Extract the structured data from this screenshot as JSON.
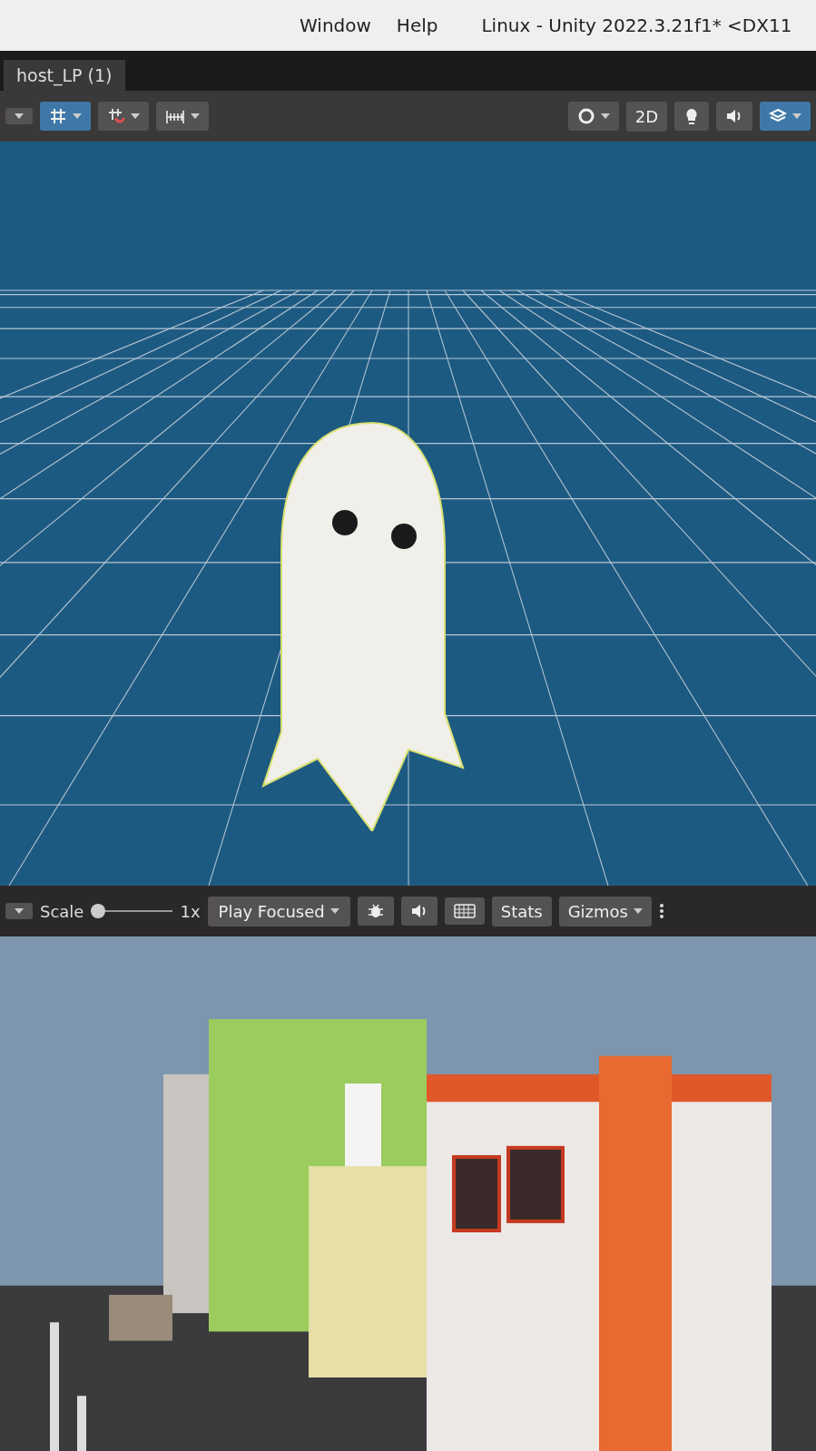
{
  "window": {
    "menu": [
      "Window",
      "Help"
    ],
    "title": "Linux - Unity 2022.3.21f1* <DX11"
  },
  "scene": {
    "tab": "host_LP (1)",
    "left_tools": [
      {
        "kind": "grid",
        "selected": true
      },
      {
        "kind": "snap",
        "selected": false
      },
      {
        "kind": "ruler",
        "selected": false
      }
    ],
    "right_tools": [
      {
        "kind": "shading",
        "selected": false
      },
      {
        "kind": "mode2d",
        "label": "2D",
        "selected": false
      },
      {
        "kind": "lighting",
        "selected": false
      },
      {
        "kind": "audio",
        "selected": false
      },
      {
        "kind": "effects",
        "selected": true
      }
    ]
  },
  "game": {
    "scale": {
      "label": "Scale",
      "level": 0,
      "reading": "1x"
    },
    "play_mode": "Play Focused",
    "toggles": [
      {
        "kind": "bug",
        "selected": false
      },
      {
        "kind": "audio",
        "selected": false
      },
      {
        "kind": "keyboard",
        "selected": false
      }
    ],
    "stats": "Stats",
    "gizmos": "Gizmos"
  }
}
